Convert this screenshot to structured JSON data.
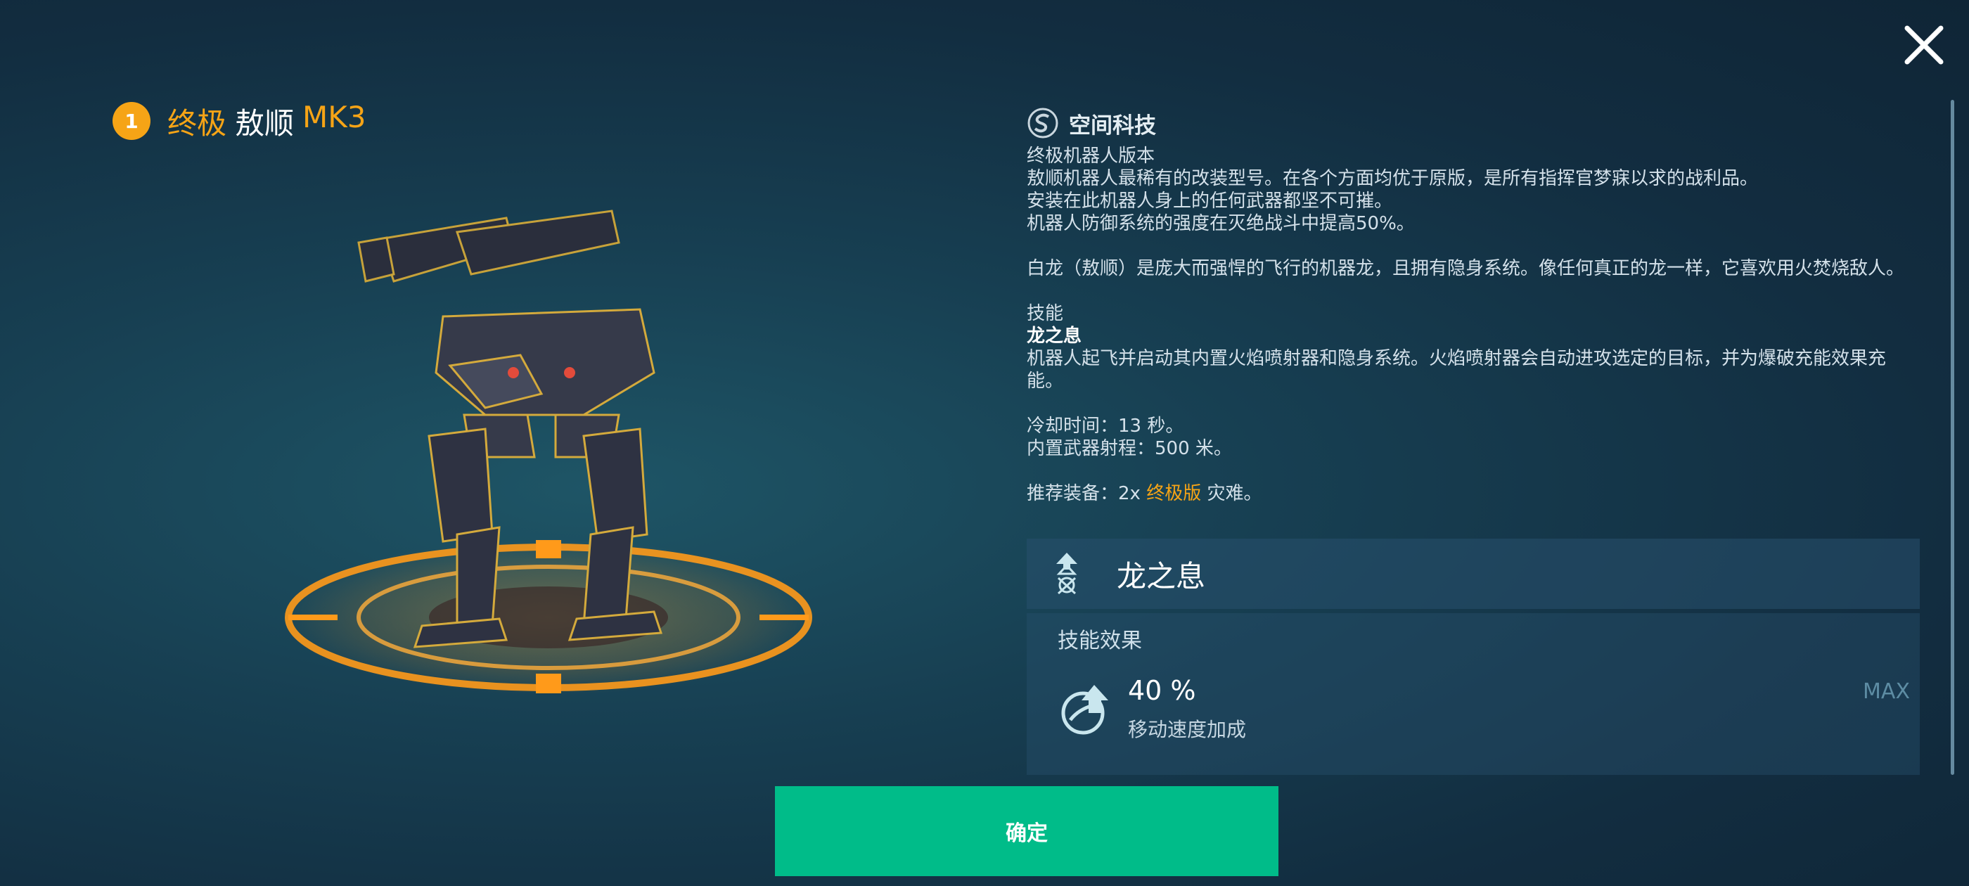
{
  "title": {
    "rank": "1",
    "tier": "终极",
    "name": "敖顺",
    "mark": "MK3"
  },
  "faction": {
    "name": "空间科技",
    "icon": "spacetech-logo-icon"
  },
  "description": {
    "line1": "终极机器人版本",
    "line2": "敖顺机器人最稀有的改装型号。在各个方面均优于原版，是所有指挥官梦寐以求的战利品。",
    "line3": "安装在此机器人身上的任何武器都坚不可摧。",
    "line4": "机器人防御系统的强度在灭绝战斗中提高50%。",
    "lore": "白龙（敖顺）是庞大而强悍的飞行的机器龙，且拥有隐身系统。像任何真正的龙一样，它喜欢用火焚烧敌人。",
    "skill_heading": "技能",
    "skill_name": "龙之息",
    "skill_desc": "机器人起飞并启动其内置火焰喷射器和隐身系统。火焰喷射器会自动进攻选定的目标，并为爆破充能效果充能。",
    "cooldown": "冷却时间：13 秒。",
    "weapon_range": "内置武器射程：500 米。",
    "recommend_prefix": "推荐装备：2x ",
    "recommend_highlight": "终极版",
    "recommend_suffix": " 灾难。"
  },
  "ability": {
    "name": "龙之息",
    "icon": "dragon-breath-ability-icon",
    "effect_title": "技能效果",
    "effect_value": "40 %",
    "effect_label": "移动速度加成",
    "effect_icon": "speed-boost-icon",
    "max_label": "MAX"
  },
  "buttons": {
    "confirm": "确定",
    "close_icon": "close-icon"
  },
  "colors": {
    "accent_gold": "#f6a416",
    "confirm_green": "#00bc89"
  }
}
